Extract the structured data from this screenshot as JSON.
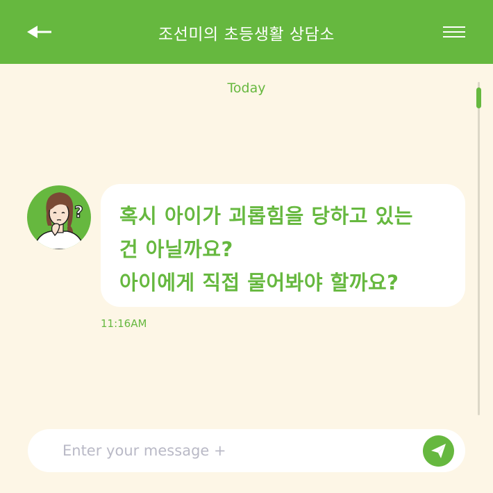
{
  "header": {
    "title": "조선미의 초등생활 상담소",
    "back_icon": "arrow-left-icon",
    "menu_icon": "hamburger-menu-icon",
    "bg_color": "#66b83f"
  },
  "chat": {
    "date_divider": "Today",
    "messages": [
      {
        "sender_avatar": "woman-thinking-avatar",
        "lines": [
          "혹시 아이가 괴롭힘을 당하고 있는",
          "건 아닐까요?",
          "아이에게 직접 물어봐야 할까요?"
        ],
        "time": "11:16AM"
      }
    ]
  },
  "composer": {
    "placeholder": "Enter your message +",
    "send_icon": "paper-plane-icon"
  },
  "colors": {
    "accent": "#66b83f",
    "background": "#fdf6e6",
    "bubble": "#ffffff"
  }
}
